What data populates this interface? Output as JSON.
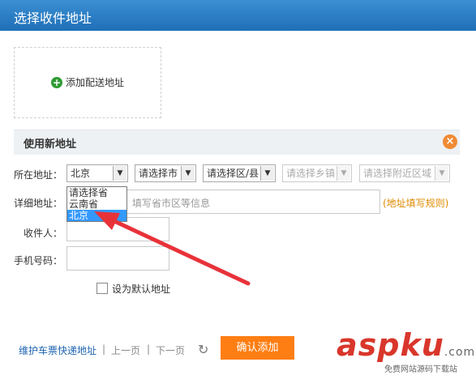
{
  "window": {
    "title": "选择收件地址"
  },
  "add_address": {
    "label": "添加配送地址"
  },
  "section": {
    "title": "使用新地址"
  },
  "form": {
    "location_label": "所在地址：",
    "province_value": "北京",
    "city_placeholder": "请选择市",
    "district_placeholder": "请选择区/县",
    "town_placeholder": "请选择乡镇",
    "nearby_placeholder": "请选择附近区域",
    "detail_label": "详细地址：",
    "detail_placeholder": "填写省市区等信息",
    "detail_rule": "(地址填写规则)",
    "receiver_label": "收件人：",
    "phone_label": "手机号码：",
    "default_checkbox_label": "设为默认地址"
  },
  "province_dropdown": {
    "options": [
      "请选择省",
      "云南省",
      "北京"
    ],
    "selected_index": 2
  },
  "footer": {
    "maintain_link": "维护车票快递地址",
    "prev": "上一页",
    "sep": "|",
    "next": "下一页",
    "confirm": "确认添加"
  },
  "watermark": {
    "main": "aspku",
    "suffix": ".com",
    "sub": "免费网站源码下载站"
  },
  "colors": {
    "accent": "#ff7e13",
    "title_bar": "#1f6fb8",
    "arrow": "#e8323a"
  }
}
